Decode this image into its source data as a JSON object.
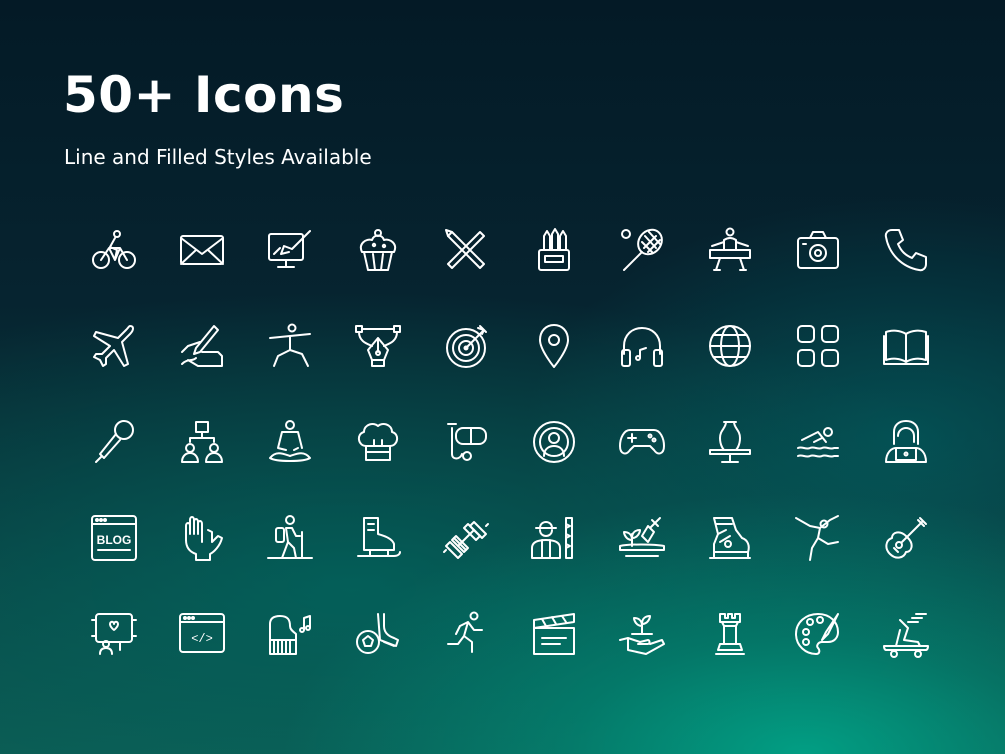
{
  "header": {
    "title": "50+ Icons",
    "subtitle": "Line and Filled Styles Available"
  },
  "icon_color": "#ffffff",
  "icons": [
    "bicycle-icon",
    "envelope-icon",
    "digital-painting-icon",
    "cupcake-icon",
    "crossed-tools-icon",
    "pencil-cup-icon",
    "tennis-racket-icon",
    "pommel-horse-icon",
    "camera-icon",
    "phone-icon",
    "airplane-icon",
    "signing-hand-icon",
    "yoga-warrior-icon",
    "pen-tool-icon",
    "target-icon",
    "location-pin-icon",
    "headphones-icon",
    "globe-icon",
    "apps-grid-icon",
    "open-book-icon",
    "microphone-icon",
    "team-hierarchy-icon",
    "meditation-icon",
    "chef-hat-icon",
    "snorkel-mask-icon",
    "podcast-icon",
    "gamepad-icon",
    "pottery-wheel-icon",
    "swimmer-icon",
    "hacker-laptop-icon",
    "blog-window-icon",
    "helping-hands-icon",
    "hiker-icon",
    "ice-skate-icon",
    "dumbbell-icon",
    "gardener-icon",
    "planting-shovel-icon",
    "ski-boot-icon",
    "ballet-dancer-icon",
    "guitar-icon",
    "selfie-stick-icon",
    "code-window-icon",
    "piano-icon",
    "soccer-kick-icon",
    "runner-icon",
    "clapperboard-icon",
    "plant-in-hand-icon",
    "chess-rook-icon",
    "palette-icon",
    "skateboard-icon"
  ],
  "blog_label": "BLOG",
  "code_label": "</>"
}
